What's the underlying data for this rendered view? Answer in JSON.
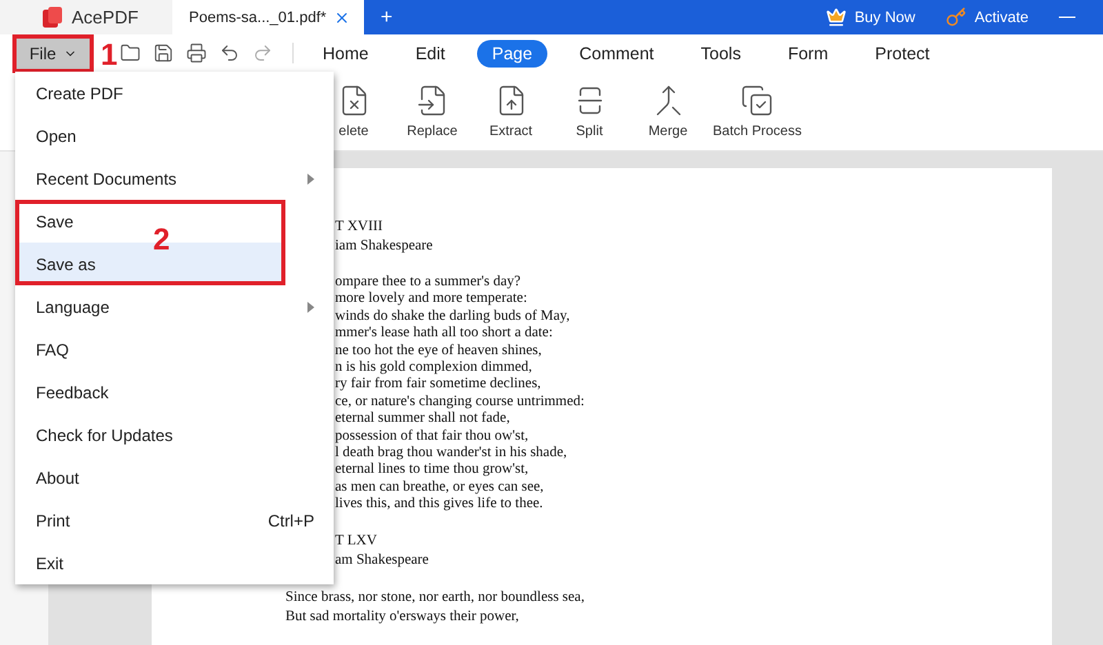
{
  "app": {
    "name": "AcePDF"
  },
  "document_tab": {
    "title": "Poems-sa..._01.pdf*"
  },
  "new_tab": "+",
  "header_actions": [
    {
      "label": "Buy Now",
      "kind": "buy"
    },
    {
      "label": "Activate",
      "kind": "activate"
    }
  ],
  "file_button": {
    "label": "File",
    "expanded": true,
    "marker": "1"
  },
  "nav_tabs": [
    {
      "label": "Home",
      "selected": false
    },
    {
      "label": "Edit",
      "selected": false
    },
    {
      "label": "Page",
      "selected": true
    },
    {
      "label": "Comment",
      "selected": false
    },
    {
      "label": "Tools",
      "selected": false
    },
    {
      "label": "Form",
      "selected": false
    },
    {
      "label": "Protect",
      "selected": false
    }
  ],
  "ribbon": [
    {
      "label": "elete",
      "kind": "delete"
    },
    {
      "label": "Replace",
      "kind": "replace"
    },
    {
      "label": "Extract",
      "kind": "extract"
    },
    {
      "label": "Split",
      "kind": "split"
    },
    {
      "label": "Merge",
      "kind": "merge"
    },
    {
      "label": "Batch Process",
      "kind": "batch"
    }
  ],
  "file_menu": {
    "marker": "2",
    "items": [
      {
        "label": "Create PDF",
        "submenu": false,
        "selected": false,
        "marked": false
      },
      {
        "label": "Open",
        "submenu": false,
        "selected": false,
        "marked": false
      },
      {
        "label": "Recent Documents",
        "submenu": true,
        "selected": false,
        "marked": false
      },
      {
        "label": "Save",
        "submenu": false,
        "selected": false,
        "marked": true
      },
      {
        "label": "Save as",
        "submenu": false,
        "selected": true,
        "marked": true
      },
      {
        "label": "Language",
        "submenu": true,
        "selected": false,
        "marked": false
      },
      {
        "label": "FAQ",
        "submenu": false,
        "selected": false,
        "marked": false
      },
      {
        "label": "Feedback",
        "submenu": false,
        "selected": false,
        "marked": false
      },
      {
        "label": "Check for Updates",
        "submenu": false,
        "selected": false,
        "marked": false
      },
      {
        "label": "About",
        "submenu": false,
        "selected": false,
        "marked": false
      },
      {
        "label": "Print",
        "shortcut": "Ctrl+P",
        "submenu": false,
        "selected": false,
        "marked": false
      },
      {
        "label": "Exit",
        "submenu": false,
        "selected": false,
        "marked": false
      }
    ]
  },
  "page": {
    "blocks": [
      {
        "kind": "partial",
        "lines": [
          "T XVIII",
          "iam Shakespeare"
        ]
      },
      {
        "kind": "partial",
        "lines": [
          "ompare thee to a summer's day?",
          "more lovely and more temperate:",
          "winds do shake the darling buds of May,",
          "mmer's lease hath all too short a date:",
          "ne too hot the eye of heaven shines,",
          "n is his gold complexion dimmed,",
          "ry fair from fair sometime declines,",
          "ce, or nature's changing course untrimmed:",
          "eternal summer shall not fade,",
          "possession of that fair thou ow'st,",
          "l death brag thou wander'st in his shade,",
          "eternal lines to time thou grow'st,",
          "as men can breathe, or eyes can see,",
          "lives this, and this gives life to thee."
        ]
      },
      {
        "kind": "partial",
        "lines": [
          "T LXV",
          "am Shakespeare"
        ]
      },
      {
        "kind": "full",
        "lines": [
          "Since brass, nor stone, nor earth, nor boundless sea,",
          "But sad mortality o'ersways their power,"
        ]
      }
    ]
  }
}
